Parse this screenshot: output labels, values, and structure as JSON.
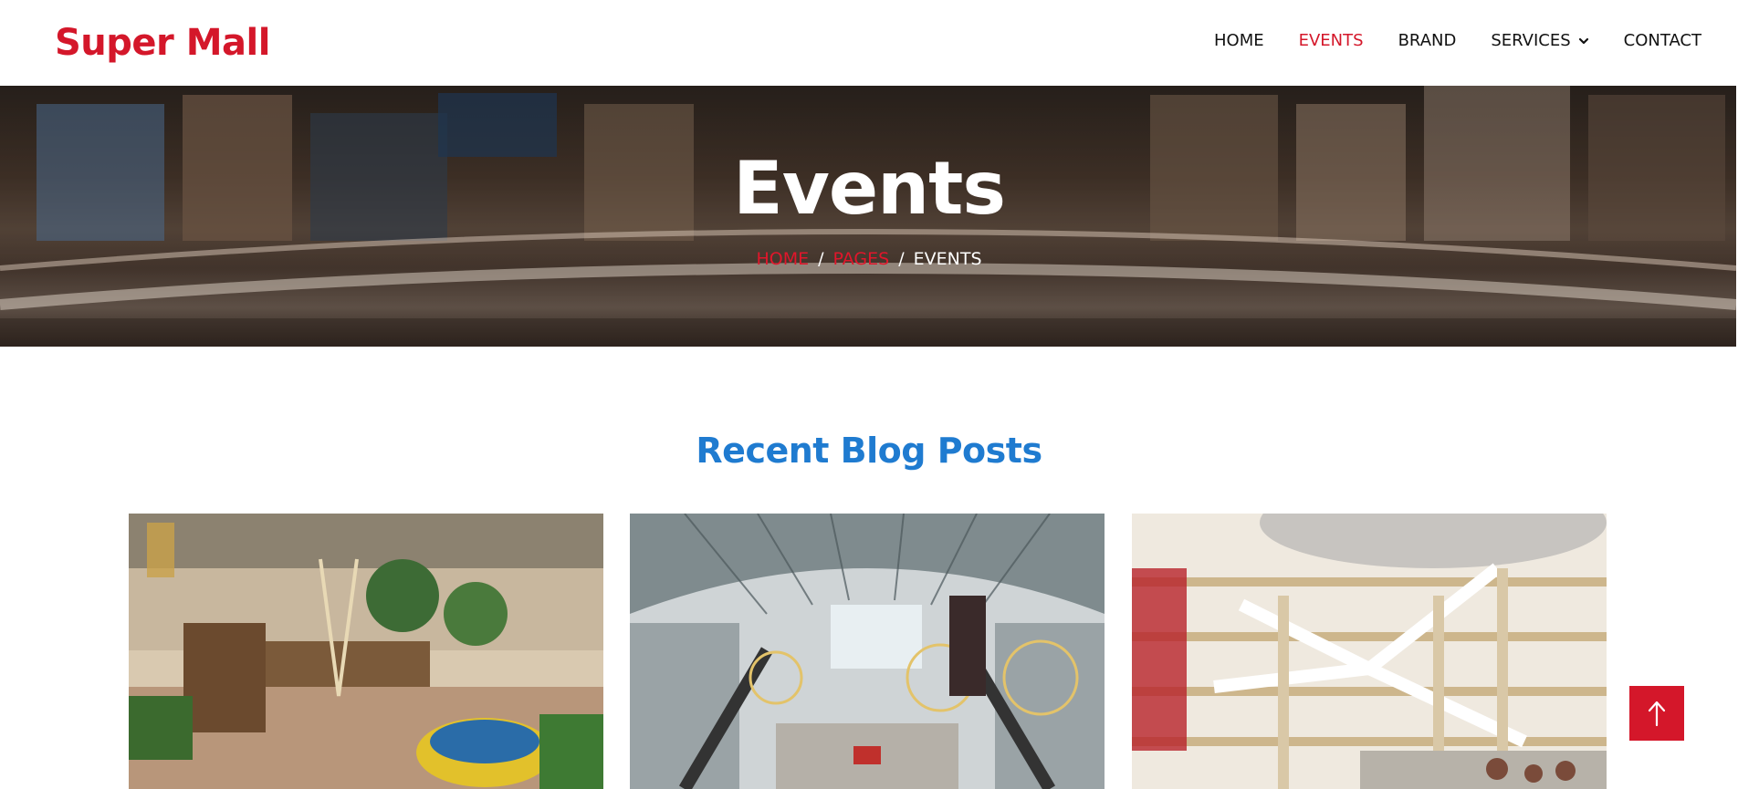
{
  "header": {
    "logo": "Super Mall",
    "nav": [
      {
        "label": "HOME",
        "active": false
      },
      {
        "label": "EVENTS",
        "active": true
      },
      {
        "label": "BRAND",
        "active": false
      },
      {
        "label": "SERVICES",
        "active": false,
        "has_dropdown": true
      },
      {
        "label": "CONTACT",
        "active": false
      }
    ]
  },
  "hero": {
    "title": "Events",
    "breadcrumb": [
      "HOME",
      "PAGES",
      "EVENTS"
    ],
    "separator": "/"
  },
  "section": {
    "title": "Recent Blog Posts"
  },
  "posts": [
    {
      "image": "mall-atrium-boat-display-photo"
    },
    {
      "image": "mall-glass-roof-escalators-photo"
    },
    {
      "image": "mall-multilevel-atrium-stairs-photo"
    }
  ],
  "colors": {
    "brand_red": "#d4172a",
    "heading_blue": "#1f7bd0"
  },
  "icons": {
    "dropdown": "chevron-down-icon",
    "back_to_top": "arrow-up-icon"
  }
}
